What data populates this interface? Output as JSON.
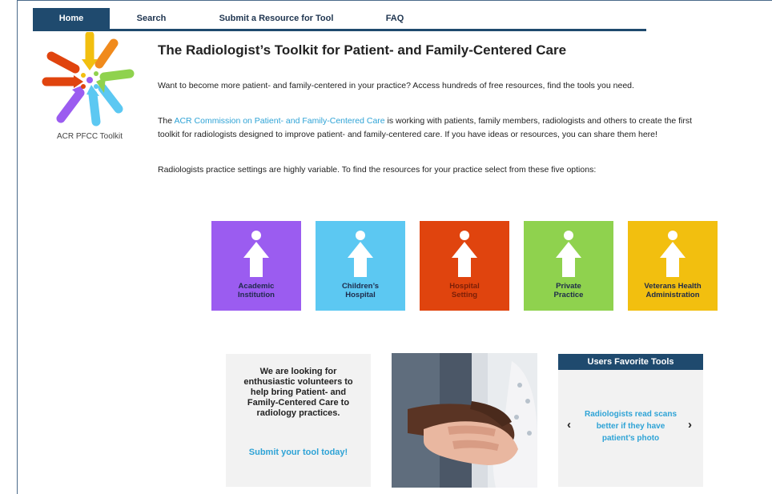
{
  "nav": {
    "items": [
      {
        "label": "Home"
      },
      {
        "label": "Search"
      },
      {
        "label": "Submit a Resource for Tool"
      },
      {
        "label": "FAQ"
      }
    ]
  },
  "logo": {
    "caption": "ACR PFCC Toolkit"
  },
  "page": {
    "title": "The Radiologist’s Toolkit for Patient- and Family-Centered Care",
    "intro": "Want to become more patient- and family-centered in your practice? Access hundreds of free resources, find the tools you need.",
    "para2_prefix": "The ",
    "para2_link": "ACR Commission on Patient- and Family-Centered Care",
    "para2_suffix": " is working with patients, family members, radiologists and others to create the first",
    "para2_line2": "toolkit for radiologists designed to improve patient- and family-centered care. If you have ideas or resources, you can share them here!",
    "settings_text": "Radiologists practice settings are highly variable. To find the resources for your practice select from these five options:"
  },
  "tiles": [
    {
      "label": "Academic\nInstitution",
      "color": "#9b5cf0"
    },
    {
      "label": "Children’s\nHospital",
      "color": "#5cc8f2"
    },
    {
      "label": "Hospital\nSetting",
      "color": "#e0440e"
    },
    {
      "label": "Private\nPractice",
      "color": "#8fd24e"
    },
    {
      "label": "Veterans Health\nAdministration",
      "color": "#f2bf0f"
    }
  ],
  "volunteer": {
    "text": "We are looking for enthusiastic volunteers to help bring Patient- and Family-Centered Care to radiology practices.",
    "link": "Submit your tool today!"
  },
  "favorites": {
    "heading": "Users Favorite Tools",
    "item": "Radiologists read scans better if they have patient’s photo",
    "prev": "‹",
    "next": "›"
  },
  "colors": {
    "navy": "#1f4a6e",
    "link": "#2ea3d6"
  }
}
